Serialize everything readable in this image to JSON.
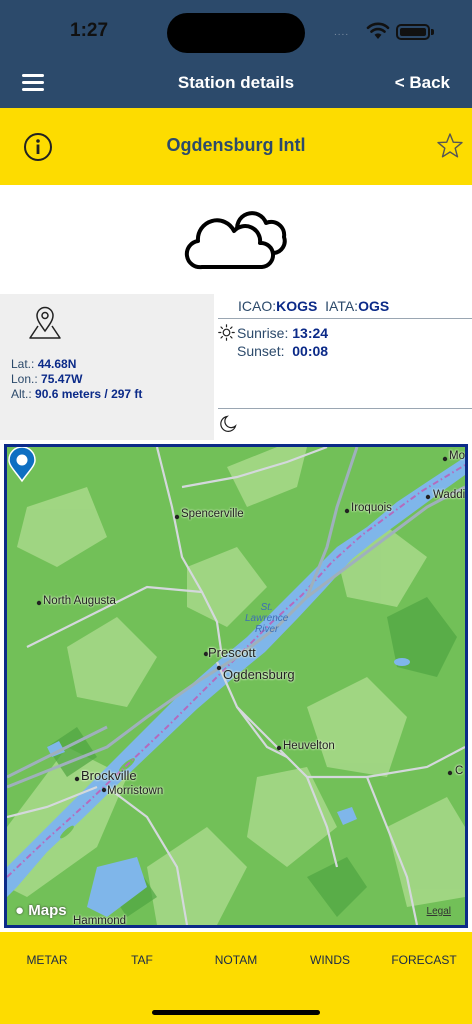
{
  "status_bar": {
    "time": "1:27",
    "signal_dots": "....",
    "battery_level": 1.0
  },
  "nav": {
    "title": "Station details",
    "back_label": "< Back"
  },
  "station": {
    "name": "Ogdensburg Intl"
  },
  "weather": {
    "condition_icon": "cloud-icon"
  },
  "location": {
    "lat_label": "Lat.:",
    "lat": "44.68N",
    "lon_label": "Lon.:",
    "lon": "75.47W",
    "alt_label": "Alt.:",
    "alt": "90.6 meters / 297 ft"
  },
  "codes": {
    "icao_label": "ICAO:",
    "icao": "KOGS",
    "iata_label": "IATA:",
    "iata": "OGS"
  },
  "sun": {
    "sunrise_label": "Sunrise:",
    "sunrise": "13:24",
    "sunset_label": "Sunset:",
    "sunset": "00:08"
  },
  "map": {
    "labels": {
      "mo": "Mo",
      "waddi": "Waddi",
      "iroquois": "Iroquois",
      "spencerville": "Spencerville",
      "north_augusta": "North Augusta",
      "river": "St.\nLawrence\nRiver",
      "prescott": "Prescott",
      "ogdensburg": "Ogdensburg",
      "heuvelton": "Heuvelton",
      "brockville": "Brockville",
      "morristown": "Morristown",
      "c": "C",
      "hammond": "Hammond"
    },
    "attribution": "Maps",
    "legal": "Legal"
  },
  "tabs": {
    "metar": "METAR",
    "taf": "TAF",
    "notam": "NOTAM",
    "winds": "WINDS",
    "forecast": "FORECAST"
  },
  "colors": {
    "nav": "#2c4a6b",
    "accent": "#fddc00",
    "value": "#0b2a88",
    "pin": "#0e6fc2"
  }
}
